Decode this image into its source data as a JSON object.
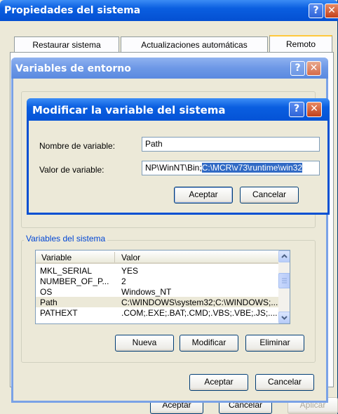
{
  "props_window": {
    "title": "Propiedades del sistema",
    "tabs": [
      "Restaurar sistema",
      "Actualizaciones automáticas",
      "Remoto"
    ],
    "buttons": {
      "ok": "Aceptar",
      "cancel": "Cancelar",
      "apply": "Aplicar"
    }
  },
  "env_window": {
    "title": "Variables de entorno",
    "system_group_label": "Variables del sistema",
    "columns": [
      "Variable",
      "Valor"
    ],
    "rows": [
      {
        "name": "MKL_SERIAL",
        "value": "YES"
      },
      {
        "name": "NUMBER_OF_P...",
        "value": "2"
      },
      {
        "name": "OS",
        "value": "Windows_NT"
      },
      {
        "name": "Path",
        "value": "C:\\WINDOWS\\system32;C:\\WINDOWS;..."
      },
      {
        "name": "PATHEXT",
        "value": ".COM;.EXE;.BAT;.CMD;.VBS;.VBE;.JS;...."
      }
    ],
    "selected_row": 3,
    "list_buttons": {
      "new": "Nueva",
      "edit": "Modificar",
      "delete": "Eliminar"
    },
    "buttons": {
      "ok": "Aceptar",
      "cancel": "Cancelar"
    }
  },
  "edit_dialog": {
    "title": "Modificar la variable del sistema",
    "name_label": "Nombre de variable:",
    "name_value": "Path",
    "value_label": "Valor de variable:",
    "value_unselected": "NP\\WinNT\\Bin;",
    "value_selected": "C:\\MCR\\v73\\runtime\\win32",
    "buttons": {
      "ok": "Aceptar",
      "cancel": "Cancelar"
    }
  },
  "captions": {
    "help": "?",
    "close": "✕"
  },
  "colors": {
    "title_blue": "#0a5ee0",
    "selection": "#316ac5",
    "face": "#ece9d8"
  }
}
